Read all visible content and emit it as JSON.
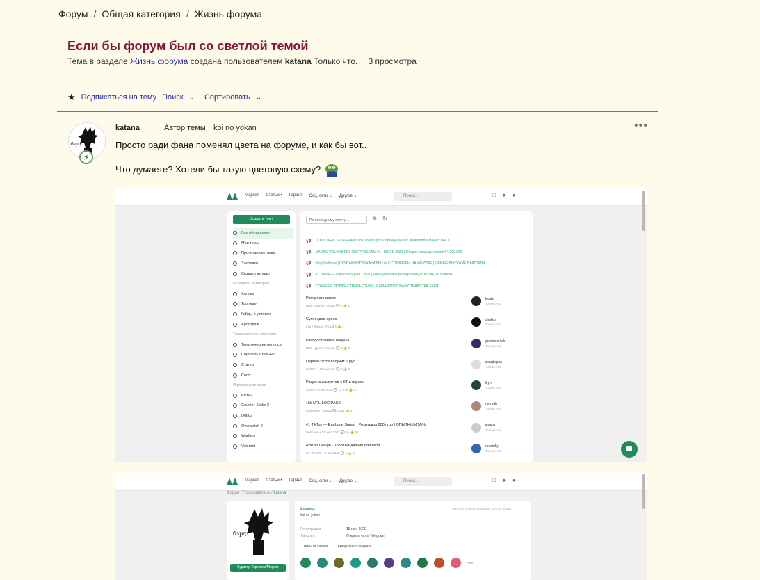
{
  "breadcrumb": [
    "Форум",
    "Общая категория",
    "Жизнь форума"
  ],
  "thread": {
    "title": "Если бы форум был со светлой темой",
    "meta_prefix": "Тема в разделе",
    "meta_section": "Жизнь форума",
    "meta_middle": "создана пользователем",
    "meta_author": "katana",
    "meta_time": "Только что.",
    "views": "3 просмотра"
  },
  "toolbar": {
    "subscribe": "Подписаться на тему",
    "search": "Поиск",
    "sort": "Сортировать"
  },
  "post": {
    "author": "katana",
    "role": "Автор темы",
    "status": "koi no yokan",
    "more": "•••",
    "line1": "Просто ради фана поменял цвета на форуме, и как бы вот..",
    "line2": "Что думаете? Хотели бы такую цветовую схему?"
  },
  "shot1": {
    "nav": [
      "Маркет",
      "Статьи •",
      "Гарант",
      "Соц. сети ⌄",
      "Другое ⌄"
    ],
    "search": "Поиск...",
    "create": "Создать тему",
    "side": [
      {
        "type": "item",
        "label": "Все обсуждения",
        "active": true
      },
      {
        "type": "item",
        "label": "Мои темы"
      },
      {
        "type": "item",
        "label": "Прочитанные темы"
      },
      {
        "type": "item",
        "label": "Закладки"
      },
      {
        "type": "item",
        "label": "Создать вкладку"
      },
      {
        "type": "head",
        "label": "Основная категория"
      },
      {
        "type": "item",
        "label": "Халява"
      },
      {
        "type": "item",
        "label": "Торговля"
      },
      {
        "type": "item",
        "label": "Гайды и утилиты"
      },
      {
        "type": "item",
        "label": "Арбитраж"
      },
      {
        "type": "head",
        "label": "Тематическая категория"
      },
      {
        "type": "item",
        "label": "Тематические вопросы"
      },
      {
        "type": "item",
        "label": "Спросить ChatGPT"
      },
      {
        "type": "item",
        "label": "Статьи"
      },
      {
        "type": "item",
        "label": "Софт"
      },
      {
        "type": "head",
        "label": "Игровая категория"
      },
      {
        "type": "item",
        "label": "PUBG"
      },
      {
        "type": "item",
        "label": "Counter-Strike 2"
      },
      {
        "type": "item",
        "label": "Dota 2"
      },
      {
        "type": "item",
        "label": "Overwatch 2"
      },
      {
        "type": "item",
        "label": "Warface"
      },
      {
        "type": "item",
        "label": "Valorant"
      }
    ],
    "sort": "По последнему ответу ⌄",
    "promos": [
      "ПОКУПАЕМ TELEGRAM // YouTooBot.pro // аренда ваших аккаунтов // НАКРУТКА TT",
      "MARKO POLO | BEST CRYPTOSCAM #1 | SINCE 2021 | Оборот команды более 94.000.000",
      "KingTrafficker | СКУПАЮ ЮТУБ КАНАЛЫ | №1 СТРИМЕРЫ НА ФОРУМЕ | САМЫЕ ВЫСОКИЕ ВЫПЛАТЫ",
      "#1 TikTok — Euphoria Squad | 35% | Еженедельные розыгрыши | ЛУЧШИЕ УСЛОВИЯ",
      "CONVERZ ЛЮБАЯ СТРАНА [TG/39] | САМАЯ ПЛОТНАЯ ОТРАБОТКА ХУКИ"
    ],
    "threads": [
      {
        "title": "Распространяем",
        "meta": "NH8 • Минуту назад 💬 0 👍 1",
        "tag": "",
        "user": "krzdy",
        "time": "Только что",
        "ava": "#222"
      },
      {
        "title": "Суспендом кросс",
        "meta": "mix • Только что 💬 1 👍 1",
        "tag": "",
        "user": "chutko",
        "time": "Только что",
        "ava": "#111"
      },
      {
        "title": "Распространите пацаны",
        "meta": "NH8 • Долгое время 💬 1 👍 0",
        "tag": "",
        "user": "gnomsheitek",
        "time": "Только что",
        "ava": "#3a2a6a"
      },
      {
        "title": "Первая сутта получит 1 руб.",
        "meta": "ОМЕГА • Только что 💬 0 👍 0",
        "tag": "",
        "user": "кешферах",
        "time": "Только что",
        "ava": "#ddd"
      },
      {
        "title": "Раздача аккаунтов с КТ и играми",
        "meta": "Steam • 9 авг 2023 💬 12 879 👍 27",
        "tag": "Steam",
        "user": "lilyrr",
        "time": "Только что",
        "ava": "#224433"
      },
      {
        "title": "1kk URL:LOG:PASS",
        "meta": "Logingers • Вчера 💬 1 131 👍 1",
        "tag": "Logingers",
        "user": "morbuh",
        "time": "Только что",
        "ava": "#aa8877"
      },
      {
        "title": "#1 TikTok — Euphoria Squad | Розыгрыш 200k rub | ОПЫТНЫМ 55%",
        "meta": "Unknown • 26 июл 2023 💬 16 👍 39",
        "tag": "Unknown",
        "user": "kurk-b",
        "time": "Только что",
        "ava": "#ccc"
      },
      {
        "title": "Ronzin Design - Топовый дизайн для тебя.",
        "meta": "2k • Ronzin • 9 авг 2023 💬 1 👍 3",
        "tag": "2k",
        "user": "ronzinfty",
        "time": "Только что",
        "ava": "#3366aa"
      }
    ]
  },
  "shot2": {
    "nav": [
      "Маркет",
      "Статьи •",
      "Гарант",
      "Соц. сети ⌄",
      "Другое ⌄"
    ],
    "search": "Поиск...",
    "crumb_a": "Форум",
    "crumb_b": "Пользователи",
    "crumb_c": "katana",
    "name": "katana",
    "status": "koi no yokan",
    "seen": "Смотрит список разделов · 30 окт. назад",
    "reg_key": "Регистрация",
    "reg_val": "15 июн 2020",
    "tg_key": "Telegram",
    "tg_val": "Открыть чат в Telegram",
    "link1": "Темы от katana",
    "link2": "Аккаунты на маркете",
    "rank": "Куратор Торговли/Маркет",
    "badges": [
      "#1f8a5a",
      "#2a8a7a",
      "#6a6a2a",
      "#1f9a8a",
      "#2a7a6a",
      "#5a3a8a",
      "#2a8a8a",
      "#1f7a4a",
      "#c04a2a",
      "#e05a7a"
    ]
  }
}
